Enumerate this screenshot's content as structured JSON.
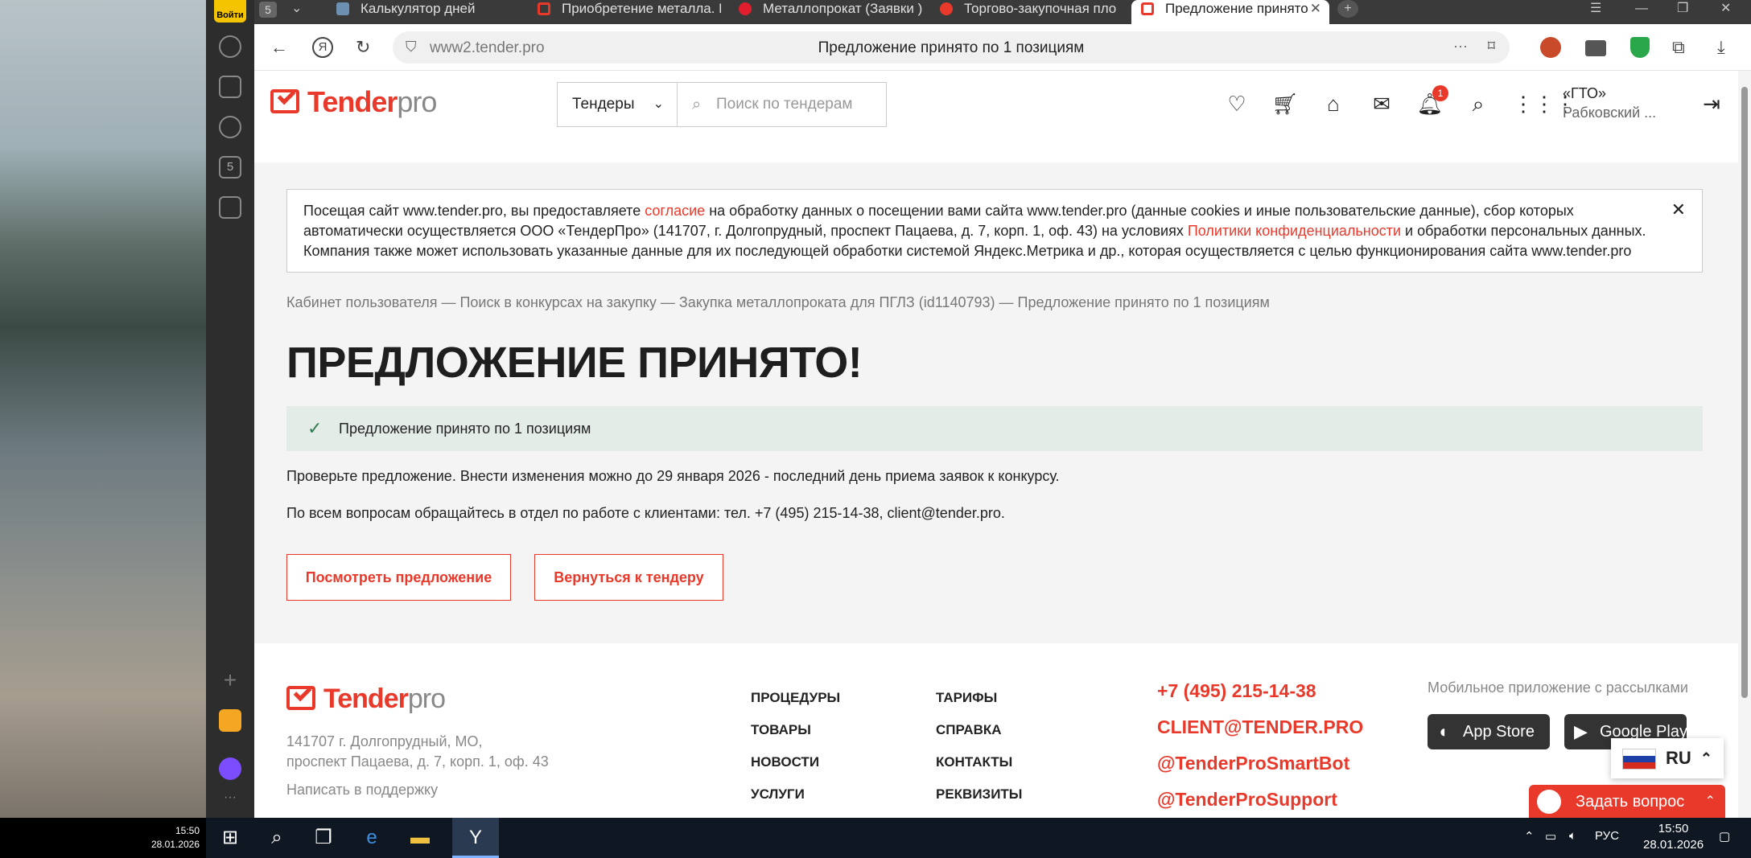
{
  "desktop": {
    "clock_time": "15:50",
    "clock_date": "28.01.2026"
  },
  "sidepanel": {
    "login_label": "Войти",
    "badge": "5"
  },
  "tabs": {
    "count": "5",
    "items": [
      {
        "label": "Калькулятор дней"
      },
      {
        "label": "Приобретение металла. Б"
      },
      {
        "label": "Металлопрокат (Заявки )"
      },
      {
        "label": "Торгово-закупочная пло"
      },
      {
        "label": "Предложение принято"
      }
    ]
  },
  "addressbar": {
    "url": "www2.tender.pro",
    "title": "Предложение принято по 1 позициям"
  },
  "header": {
    "logo_main": "Tender",
    "logo_suffix": "pro",
    "select_value": "Тендеры",
    "search_placeholder": "Поиск по тендерам",
    "notif_count": "1",
    "company_name": "«ГТО»",
    "company_user": "Рабковский ..."
  },
  "cookie": {
    "text1": "Посещая сайт www.tender.pro, вы предоставляете ",
    "link1": "согласие",
    "text2": " на обработку данных о посещении вами сайта www.tender.pro (данные cookies и иные пользовательские данные), сбор которых автоматически осуществляется ООО «ТендерПро» (141707, г. Долгопрудный, проспект Пацаева, д. 7, корп. 1, оф. 43) на условиях ",
    "link2": "Политики конфиденциальности",
    "text3": " и обработки персональных данных. Компания также может использовать указанные данные для их последующей обработки системой Яндекс.Метрика и др., которая осуществляется с целью функционирования сайта www.tender.pro"
  },
  "breadcrumb": "Кабинет пользователя — Поиск в конкурсах на закупку — Закупка металлопроката для ПГЛЗ (id1140793) — Предложение принято по 1 позициям",
  "page_title": "ПРЕДЛОЖЕНИЕ ПРИНЯТО!",
  "success_msg": "Предложение принято по 1 позициям",
  "info1": "Проверьте предложение. Внести изменения можно до 29 января 2026 - последний день приема заявок к конкурсу.",
  "info2": "По всем вопросам обращайтесь в отдел по работе с клиентами: тел. +7 (495) 215-14-38, client@tender.pro.",
  "buttons": {
    "view": "Посмотреть предложение",
    "back": "Вернуться к тендеру"
  },
  "footer": {
    "address1": "141707 г. Долгопрудный, МО,",
    "address2": "проспект Пацаева, д. 7, корп. 1, оф. 43",
    "support": "Написать в поддержку",
    "col1": [
      "ПРОЦЕДУРЫ",
      "ТОВАРЫ",
      "НОВОСТИ",
      "УСЛУГИ"
    ],
    "col2": [
      "ТАРИФЫ",
      "СПРАВКА",
      "КОНТАКТЫ",
      "РЕКВИЗИТЫ"
    ],
    "contacts": [
      "+7 (495) 215-14-38",
      "CLIENT@TENDER.PRO",
      "@TenderProSmartBot",
      "@TenderProSupport"
    ],
    "app_title": "Мобильное приложение с рассылками",
    "appstore": "App Store",
    "googleplay": "Google Play"
  },
  "widgets": {
    "lang": "RU",
    "ask": "Задать вопрос"
  },
  "taskbar": {
    "lang": "РУС",
    "time": "15:50",
    "date": "28.01.2026"
  },
  "colors": {
    "brand": "#e8392b",
    "success_bg": "#e4ece8"
  }
}
